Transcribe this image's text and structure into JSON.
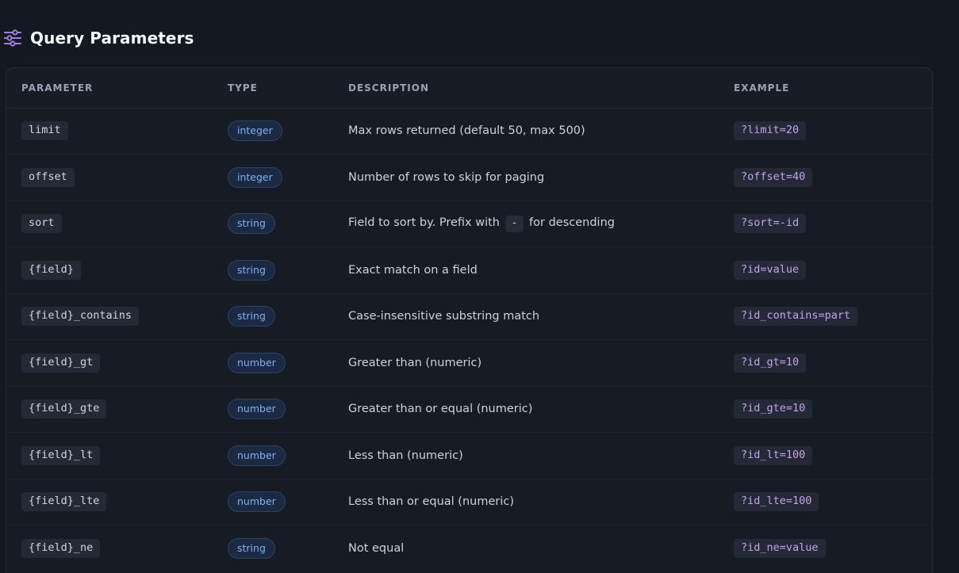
{
  "section": {
    "title": "Query Parameters",
    "icon": "sliders-icon",
    "accent_color": "#a77ddf"
  },
  "table": {
    "headers": {
      "parameter": "PARAMETER",
      "type": "TYPE",
      "description": "DESCRIPTION",
      "example": "EXAMPLE"
    },
    "rows": [
      {
        "param": "limit",
        "type": "integer",
        "desc_pre": "Max rows returned (default 50, max 500)",
        "desc_code": "",
        "desc_post": "",
        "example": "?limit=20"
      },
      {
        "param": "offset",
        "type": "integer",
        "desc_pre": "Number of rows to skip for paging",
        "desc_code": "",
        "desc_post": "",
        "example": "?offset=40"
      },
      {
        "param": "sort",
        "type": "string",
        "desc_pre": "Field to sort by. Prefix with",
        "desc_code": "-",
        "desc_post": "for descending",
        "example": "?sort=-id"
      },
      {
        "param": "{field}",
        "type": "string",
        "desc_pre": "Exact match on a field",
        "desc_code": "",
        "desc_post": "",
        "example": "?id=value"
      },
      {
        "param": "{field}_contains",
        "type": "string",
        "desc_pre": "Case-insensitive substring match",
        "desc_code": "",
        "desc_post": "",
        "example": "?id_contains=part"
      },
      {
        "param": "{field}_gt",
        "type": "number",
        "desc_pre": "Greater than (numeric)",
        "desc_code": "",
        "desc_post": "",
        "example": "?id_gt=10"
      },
      {
        "param": "{field}_gte",
        "type": "number",
        "desc_pre": "Greater than or equal (numeric)",
        "desc_code": "",
        "desc_post": "",
        "example": "?id_gte=10"
      },
      {
        "param": "{field}_lt",
        "type": "number",
        "desc_pre": "Less than (numeric)",
        "desc_code": "",
        "desc_post": "",
        "example": "?id_lt=100"
      },
      {
        "param": "{field}_lte",
        "type": "number",
        "desc_pre": "Less than or equal (numeric)",
        "desc_code": "",
        "desc_post": "",
        "example": "?id_lte=100"
      },
      {
        "param": "{field}_ne",
        "type": "string",
        "desc_pre": "Not equal",
        "desc_code": "",
        "desc_post": "",
        "example": "?id_ne=value"
      }
    ]
  }
}
